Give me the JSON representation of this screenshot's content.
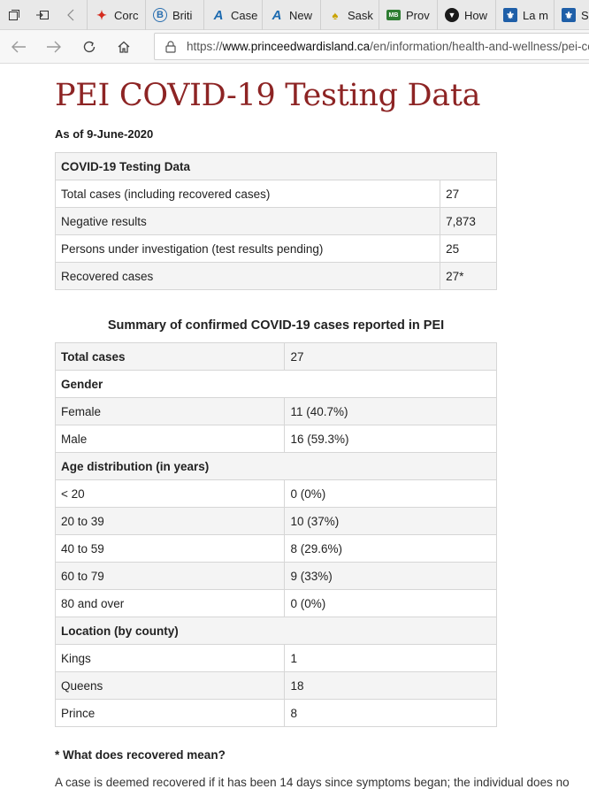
{
  "browser": {
    "tabs": [
      {
        "label": "Corc",
        "icon": "maple-leaf-icon",
        "color": "#d52b1e"
      },
      {
        "label": "Briti",
        "icon": "bc-shield-icon",
        "color": "#2a6fb0"
      },
      {
        "label": "Case",
        "icon": "alberta-icon",
        "color": "#1c6ab0"
      },
      {
        "label": "New",
        "icon": "alberta-icon",
        "color": "#1c6ab0"
      },
      {
        "label": "Sask",
        "icon": "wheat-icon",
        "color": "#c9a300"
      },
      {
        "label": "Prov",
        "icon": "manitoba-icon",
        "color": "#2e7d32"
      },
      {
        "label": "How",
        "icon": "ontario-trillium-icon",
        "color": "#1a1a1a"
      },
      {
        "label": "La m",
        "icon": "quebec-fleur-icon",
        "color": "#1f5fa8"
      },
      {
        "label": "S",
        "icon": "quebec-fleur-icon",
        "color": "#1f5fa8"
      }
    ],
    "url": {
      "scheme": "https://",
      "host": "www.princeedwardisland.ca",
      "path": "/en/information/health-and-wellness/pei-co"
    }
  },
  "page": {
    "title": "PEI COVID-19 Testing Data",
    "as_of": "As of 9-June-2020"
  },
  "testing_table": {
    "header": "COVID-19 Testing Data",
    "rows": [
      {
        "label": "Total cases (including recovered cases)",
        "value": "27"
      },
      {
        "label": "Negative results",
        "value": "7,873"
      },
      {
        "label": "Persons under investigation (test results pending)",
        "value": "25"
      },
      {
        "label": "Recovered cases",
        "value": "27*"
      }
    ]
  },
  "summary": {
    "caption": "Summary of confirmed COVID-19 cases reported in PEI",
    "total_label": "Total cases",
    "total_value": "27",
    "gender_header": "Gender",
    "gender": [
      {
        "label": "Female",
        "value": "11 (40.7%)"
      },
      {
        "label": "Male",
        "value": "16 (59.3%)"
      }
    ],
    "age_header": "Age distribution (in years)",
    "age": [
      {
        "label": "< 20",
        "value": "0 (0%)"
      },
      {
        "label": "20 to 39",
        "value": "10 (37%)"
      },
      {
        "label": "40 to 59",
        "value": "8 (29.6%)"
      },
      {
        "label": "60 to 79",
        "value": "9 (33%)"
      },
      {
        "label": "80 and over",
        "value": "0 (0%)"
      }
    ],
    "location_header": "Location (by county)",
    "location": [
      {
        "label": "Kings",
        "value": "1"
      },
      {
        "label": "Queens",
        "value": "18"
      },
      {
        "label": "Prince",
        "value": "8"
      }
    ]
  },
  "note": {
    "heading": "* What does recovered mean?",
    "text": "A case is deemed recovered if it has been 14 days since symptoms began; the individual does no"
  }
}
